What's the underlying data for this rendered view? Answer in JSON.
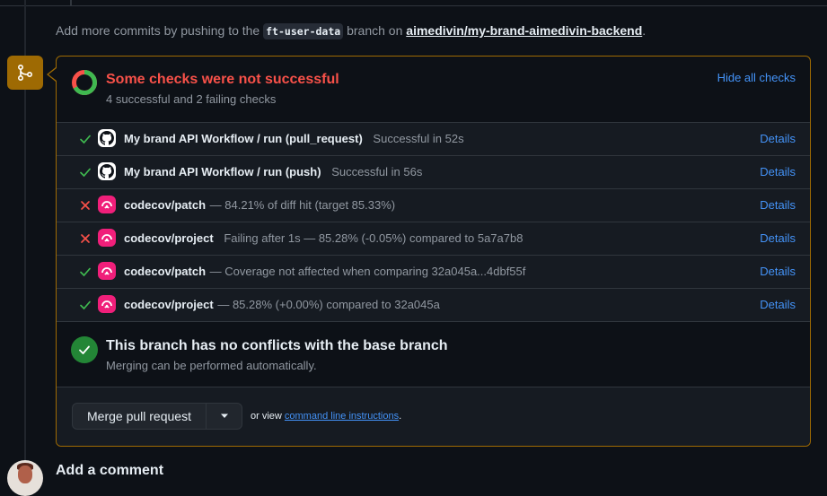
{
  "push_note": {
    "prefix": "Add more commits by pushing to the",
    "branch": "ft-user-data",
    "middle": "branch on",
    "repo": "aimedivin/my-brand-aimedivin-backend",
    "suffix": "."
  },
  "checks": {
    "title": "Some checks were not successful",
    "subtitle": "4 successful and 2 failing checks",
    "hide_label": "Hide all checks",
    "successful": 4,
    "failing": 2,
    "colors": {
      "success": "#3fb950",
      "failure": "#f85149",
      "warning": "#9e6a03",
      "link": "#4493f8"
    },
    "items": [
      {
        "status": "success",
        "app_icon": "github-icon",
        "name": "My brand API Workflow / run (pull_request)",
        "description": "Successful in 52s",
        "details_label": "Details"
      },
      {
        "status": "success",
        "app_icon": "github-icon",
        "name": "My brand API Workflow / run (push)",
        "description": "Successful in 56s",
        "details_label": "Details"
      },
      {
        "status": "failure",
        "app_icon": "codecov-icon",
        "name": "codecov/patch",
        "description": "— 84.21% of diff hit (target 85.33%)",
        "details_label": "Details"
      },
      {
        "status": "failure",
        "app_icon": "codecov-icon",
        "name": "codecov/project",
        "description": "Failing after 1s — 85.28% (-0.05%) compared to 5a7a7b8",
        "details_label": "Details"
      },
      {
        "status": "success",
        "app_icon": "codecov-icon",
        "name": "codecov/patch",
        "description": "— Coverage not affected when comparing 32a045a...4dbf55f",
        "details_label": "Details"
      },
      {
        "status": "success",
        "app_icon": "codecov-icon",
        "name": "codecov/project",
        "description": "— 85.28% (+0.00%) compared to 32a045a",
        "details_label": "Details"
      }
    ]
  },
  "conflicts": {
    "title": "This branch has no conflicts with the base branch",
    "subtitle": "Merging can be performed automatically."
  },
  "merge": {
    "button_label": "Merge pull request",
    "alt_prefix": "or view",
    "alt_link": "command line instructions",
    "alt_suffix": "."
  },
  "comment": {
    "title": "Add a comment"
  }
}
